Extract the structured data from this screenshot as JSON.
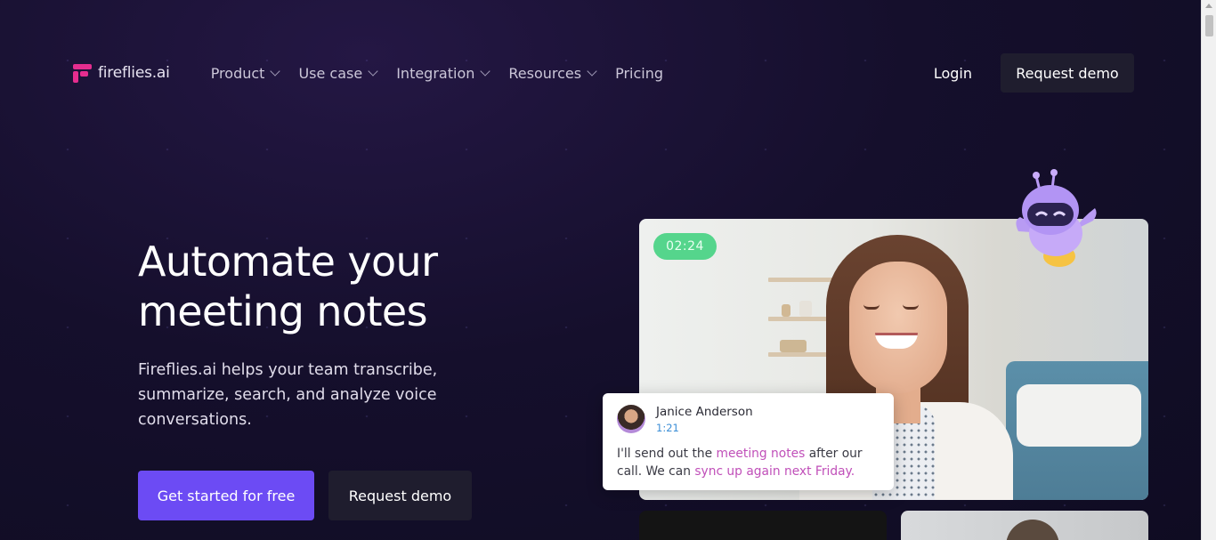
{
  "brand": {
    "name": "fireflies.ai",
    "accent": "#e52d8f",
    "primary": "#6c4bf4"
  },
  "nav": {
    "items": [
      {
        "label": "Product",
        "dropdown": true
      },
      {
        "label": "Use case",
        "dropdown": true
      },
      {
        "label": "Integration",
        "dropdown": true
      },
      {
        "label": "Resources",
        "dropdown": true
      },
      {
        "label": "Pricing",
        "dropdown": false
      }
    ],
    "login": "Login",
    "request_demo": "Request demo"
  },
  "hero": {
    "headline_line1": "Automate your",
    "headline_line2": "meeting notes",
    "subtitle": "Fireflies.ai helps your team transcribe, summarize, search, and analyze voice conversations.",
    "cta_primary": "Get started for free",
    "cta_secondary": "Request demo"
  },
  "video": {
    "timer": "02:24",
    "transcript": {
      "speaker": "Janice Anderson",
      "time": "1:21",
      "text_1": "I'll send out the ",
      "highlight_1": "meeting notes",
      "text_2": " after our call. We can ",
      "highlight_2": "sync up again next Friday."
    }
  },
  "icons": {
    "logo": "fireflies-logo-icon",
    "robot": "robot-mascot-icon",
    "chevron": "chevron-down-icon"
  }
}
